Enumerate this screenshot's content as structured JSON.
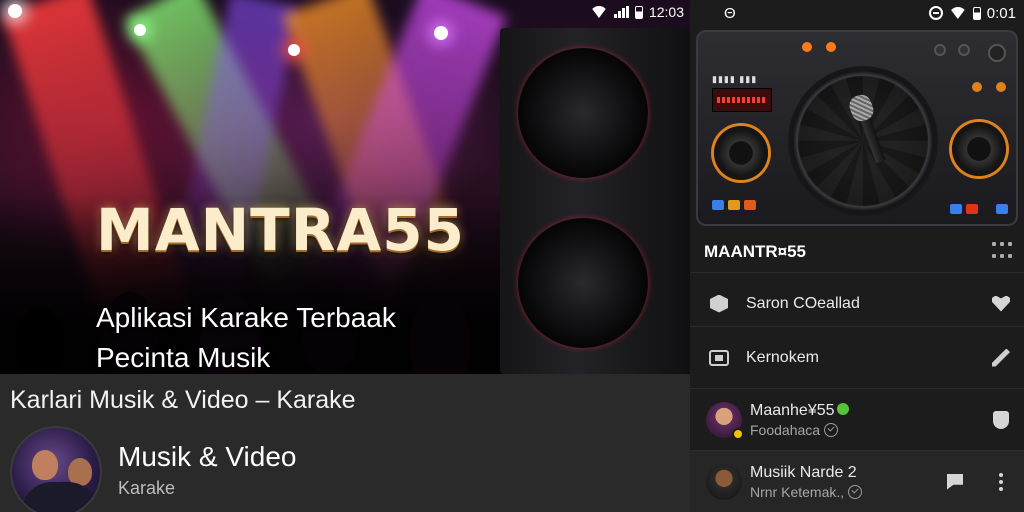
{
  "left": {
    "status": {
      "time": "12:03"
    },
    "hero": {
      "brand": "MANTRA55",
      "tagline_line1": "Aplikasi Karake Terbaak",
      "tagline_line2": "Pecinta Musik"
    },
    "strip": {
      "title": "Karlari Musik & Video  –  Karake",
      "channel_name": "Musik & Video",
      "channel_sub": "Karake"
    }
  },
  "right": {
    "status": {
      "left_glyph": "Θ",
      "time": "0:01"
    },
    "app_title": "MAANTR¤55",
    "items": [
      {
        "label": "Saron COeallad",
        "lead_icon": "hexagon-icon",
        "trail_icon": "heart-icon"
      },
      {
        "label": "Kernokem",
        "lead_icon": "tv-icon",
        "trail_icon": "pencil-icon"
      },
      {
        "label": "Maanhe¥55",
        "sub": "Foodahaca",
        "lead_icon": "avatar",
        "trail_icon": "shield-icon"
      },
      {
        "label": "Musiik Narde 2",
        "sub": "Nrnr Ketemak.,",
        "lead_icon": "avatar",
        "trail_icons": [
          "flag-icon",
          "kebab-icon"
        ]
      }
    ]
  },
  "colors": {
    "accent_orange": "#e0821c",
    "panel_dark": "#1c1c1c",
    "strip_bg": "#2a2a2a"
  }
}
